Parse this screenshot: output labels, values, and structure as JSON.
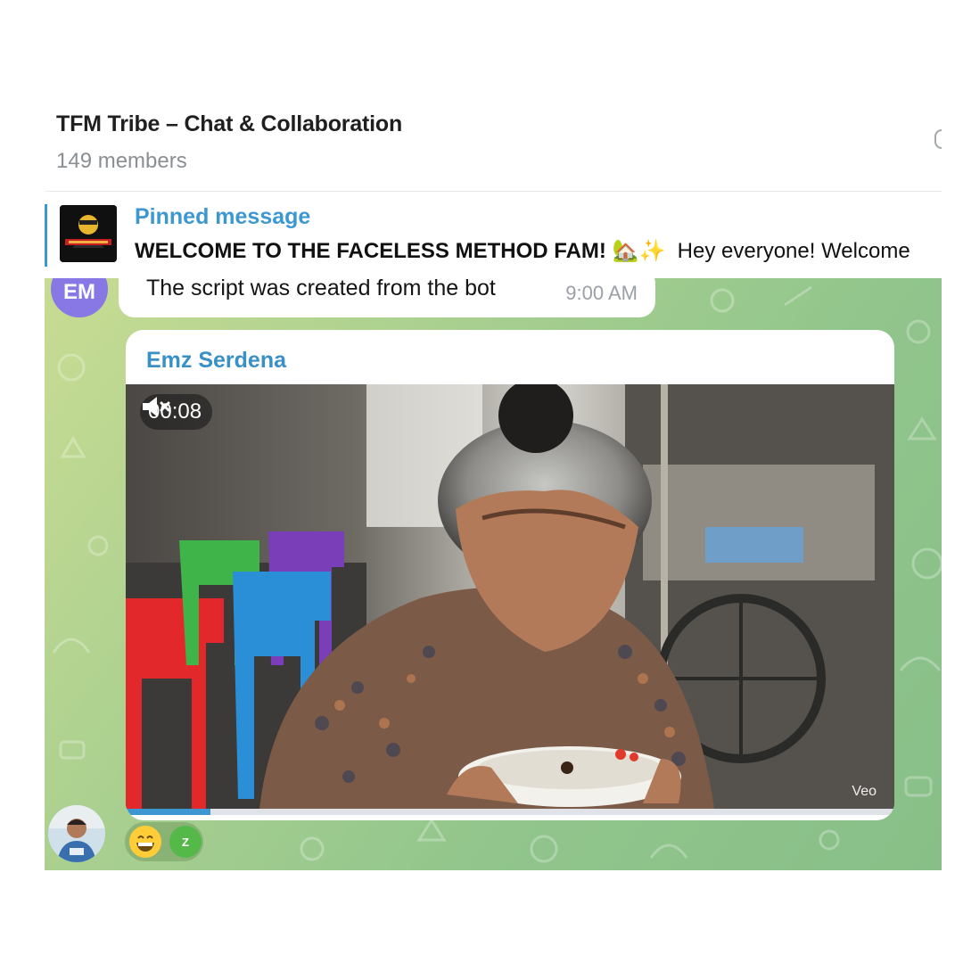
{
  "header": {
    "title": "TFM Tribe – Chat & Collaboration",
    "members": "149 members"
  },
  "pinned": {
    "label": "Pinned message",
    "title": "WELCOME TO THE FACELESS METHOD FAM!",
    "emojis": "🏡✨",
    "preview": "Hey everyone! Welcome"
  },
  "messages": {
    "previous": {
      "avatar_initials": "EM",
      "text": "The script was created from the bot",
      "time": "9:00 AM"
    },
    "video": {
      "sender": "Emz Serdena",
      "duration": "00:08",
      "muted": true,
      "watermark": "Veo",
      "progress": 0.11
    },
    "reaction": {
      "user_initial": "Z"
    }
  },
  "colors": {
    "accent": "#3d97d1",
    "sender": "#3990c7",
    "avatar": "#8878e6"
  }
}
